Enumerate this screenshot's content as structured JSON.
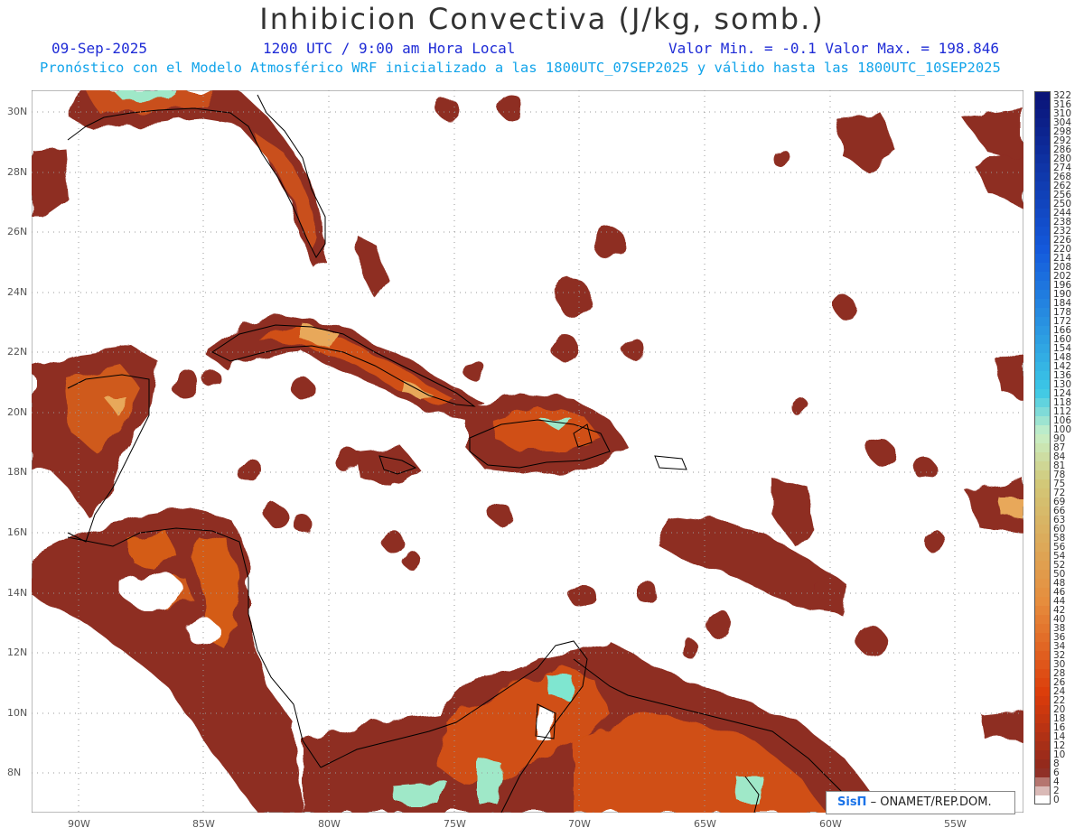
{
  "header": {
    "title": "Inhibicion Convectiva (J/kg, somb.)",
    "date": "09-Sep-2025",
    "time": "1200 UTC / 9:00 am Hora Local",
    "minmax": "Valor Min. = -0.1  Valor Max. = 198.846",
    "forecast": "Pronóstico con el Modelo Atmosférico WRF inicializado a las 1800UTC_07SEP2025 y válido hasta las  1800UTC_10SEP2025"
  },
  "map": {
    "lat_labels": [
      "30N",
      "28N",
      "26N",
      "24N",
      "22N",
      "20N",
      "18N",
      "16N",
      "14N",
      "12N",
      "10N",
      "8N"
    ],
    "lon_labels": [
      "90W",
      "85W",
      "80W",
      "75W",
      "70W",
      "65W",
      "60W",
      "55W"
    ],
    "colors": {
      "coastline": "#000000",
      "grid": "#9a9a9a",
      "field_low": "#8e2d22",
      "field_mid": "#d04a0c",
      "field_high": "#e8a85a",
      "field_peak": "#7fe6d0"
    }
  },
  "colorbar": {
    "labels": [
      "322",
      "316",
      "310",
      "304",
      "298",
      "292",
      "286",
      "280",
      "274",
      "268",
      "262",
      "256",
      "250",
      "244",
      "238",
      "232",
      "226",
      "220",
      "214",
      "208",
      "202",
      "196",
      "190",
      "184",
      "178",
      "172",
      "166",
      "160",
      "154",
      "148",
      "142",
      "136",
      "130",
      "124",
      "118",
      "112",
      "106",
      "100",
      "90",
      "87",
      "84",
      "81",
      "78",
      "75",
      "72",
      "69",
      "66",
      "63",
      "60",
      "58",
      "56",
      "54",
      "52",
      "50",
      "48",
      "46",
      "44",
      "42",
      "40",
      "38",
      "36",
      "34",
      "32",
      "30",
      "28",
      "26",
      "24",
      "22",
      "20",
      "18",
      "16",
      "14",
      "12",
      "10",
      "8",
      "6",
      "4",
      "2",
      "0"
    ]
  },
  "logo": {
    "brand": "SisΠ",
    "org": "– ONAMET/REP.DOM."
  }
}
